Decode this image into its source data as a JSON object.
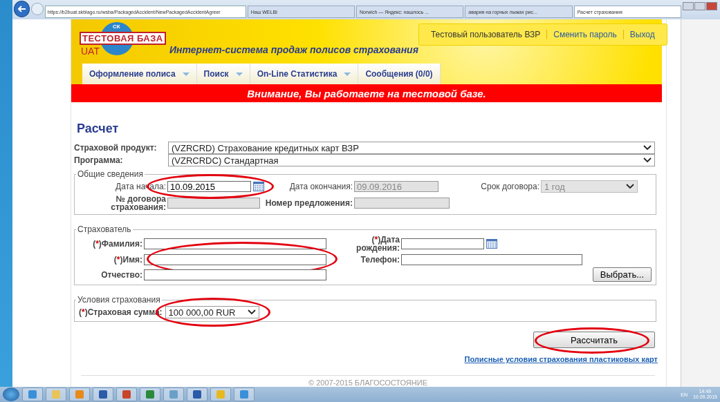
{
  "browser": {
    "address": "https://b2buat.skblago.ru/wsba/PackagedAccident/NewPackagedAccidentAgreer",
    "tabs": [
      {
        "label": "Наш WELBI",
        "selected": false
      },
      {
        "label": "Norwich — Яндекс: нашлось ...",
        "selected": false
      },
      {
        "label": "авария на горных лыжах рис...",
        "selected": false
      },
      {
        "label": "Расчет страхования",
        "selected": true
      }
    ]
  },
  "header": {
    "logo_top": "СК",
    "logo_main": "ТЕСТОВАЯ БАЗА",
    "logo_sub": "UAT",
    "tagline": "Интернет-система продаж полисов страхования",
    "user_links": [
      {
        "label": "Тестовый пользователь ВЗР",
        "kind": "text"
      },
      {
        "label": "Сменить пароль",
        "kind": "link"
      },
      {
        "label": "Выход",
        "kind": "link"
      }
    ],
    "menu": [
      {
        "label": "Оформление полиса",
        "dropdown": true
      },
      {
        "label": "Поиск",
        "dropdown": true
      },
      {
        "label": "On-Line Статистика",
        "dropdown": true
      },
      {
        "label": "Сообщения (0/0)",
        "dropdown": false
      }
    ],
    "warning": "Внимание, Вы работаете на тестовой базе."
  },
  "page_title": "Расчет",
  "product": {
    "label": "Страховой продукт:",
    "value": "(VZRCRD) Страхование кредитных карт ВЗР"
  },
  "program": {
    "label": "Программа:",
    "value": "(VZRCRDC) Стандартная"
  },
  "general": {
    "legend": "Общие сведения",
    "start": {
      "label": "Дата начала:",
      "value": "10.09.2015",
      "circled": true
    },
    "end": {
      "label": "Дата окончания:",
      "value": "09.09.2016",
      "disabled": true
    },
    "term": {
      "label": "Срок договора:",
      "value": "1 год",
      "disabled": true
    },
    "contract_no": {
      "label": "№ договора страхования:",
      "disabled": true
    },
    "offer_no": {
      "label": "Номер предложения:",
      "disabled": true
    }
  },
  "insured": {
    "legend": "Страхователь",
    "fields": [
      {
        "label": "Фамилия:",
        "required": "(*)",
        "circled": false
      },
      {
        "label": "Имя:",
        "required": "(*)",
        "circled": true
      },
      {
        "label": "Отчество:",
        "circled": false
      }
    ],
    "birth": {
      "label": "Дата рождения:",
      "required": "(*)"
    },
    "phone": {
      "label": "Телефон:"
    },
    "choose_button": "Выбрать..."
  },
  "conditions": {
    "legend": "Условия страхования",
    "label": "Страховая сумма:",
    "required": "(*)",
    "value": "100 000,00 RUR",
    "circled": true
  },
  "calculate": {
    "label": "Рассчитать",
    "circled": true
  },
  "terms_link": "Полисные условия страхования пластиковых карт",
  "footer": "© 2007-2015 БЛАГОСОСТОЯНИЕ",
  "taskbar": {
    "apps": [
      {
        "kind": "browser"
      },
      {
        "kind": "folder"
      },
      {
        "kind": "mail"
      },
      {
        "kind": "word"
      },
      {
        "kind": "slides"
      },
      {
        "kind": "sheet"
      },
      {
        "kind": "window"
      },
      {
        "kind": "word"
      },
      {
        "kind": "bell"
      },
      {
        "kind": "browser"
      }
    ],
    "lang": "EN",
    "time": "14:49",
    "date": "10.09.2015"
  }
}
